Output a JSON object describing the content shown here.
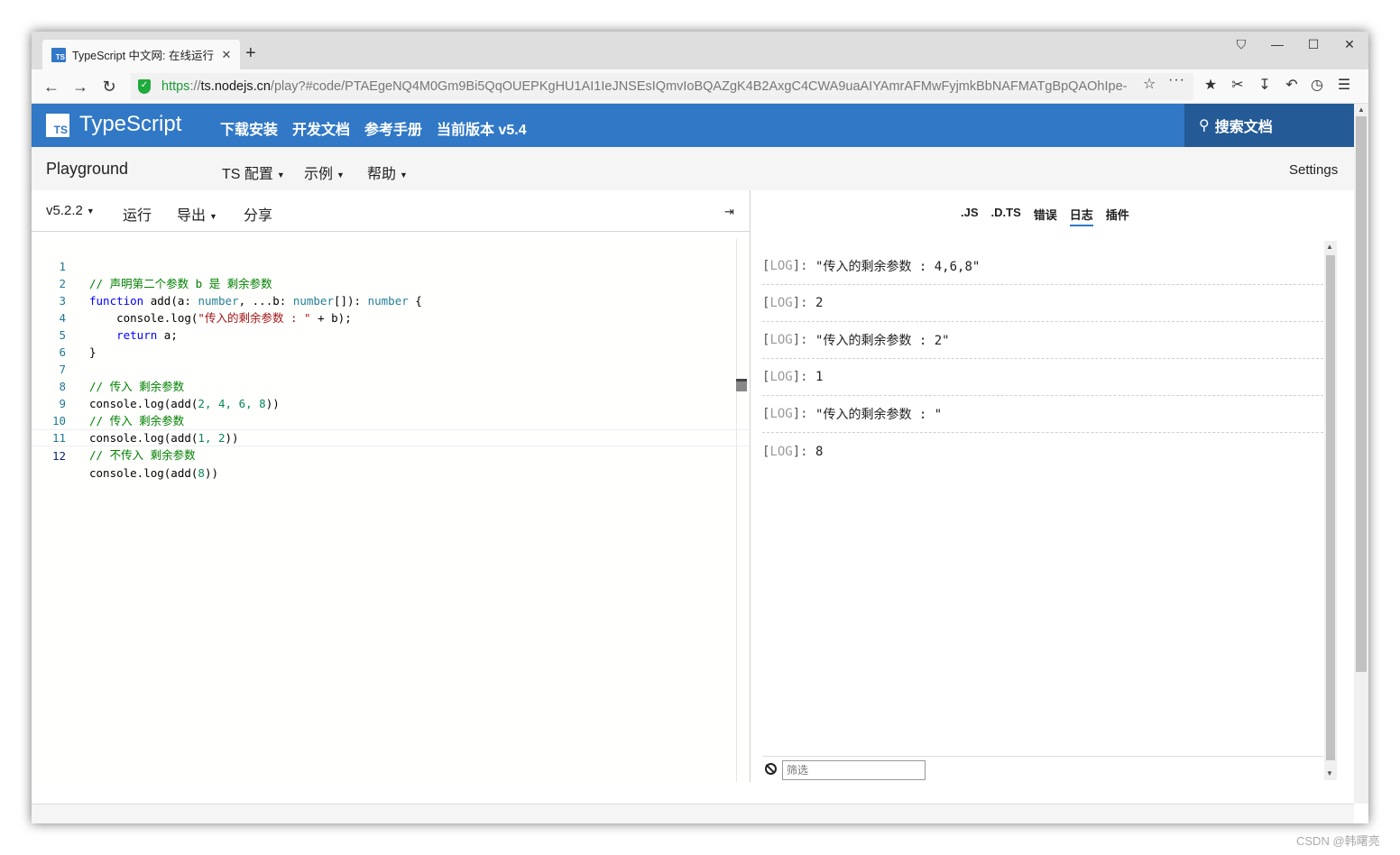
{
  "browser": {
    "tab_title": "TypeScript 中文网: 在线运行",
    "tab_favicon": "TS",
    "tab_close": "✕",
    "new_tab": "+",
    "url_scheme": "https",
    "url_sep": "://",
    "url_host": "ts.nodejs.cn",
    "url_rest": "/play?#code/PTAEgeNQ4M0Gm9Bi5QqOUEPKgHU1AI1IeJNSEsIQmvIoBQAZgK4B2AxgC4CWA9uaAIYAmrAFMwFyjmkBbNAFMATgBpQAOhIpe-",
    "window_controls": [
      "⛉",
      "—",
      "☐",
      "✕"
    ],
    "nav_icons": [
      "arrow-left-icon",
      "arrow-right-icon",
      "reload-icon"
    ],
    "toolbar_icons": [
      "star-list-icon",
      "scissors-icon",
      "download-icon",
      "undo-icon",
      "history-icon",
      "menu-icon"
    ]
  },
  "site": {
    "logo_box": "TS",
    "logo_text": "TypeScript",
    "nav": [
      "下载安装",
      "开发文档",
      "参考手册",
      "当前版本 v5.4"
    ],
    "search_label": "搜索文档",
    "brand_color": "#3178c6"
  },
  "playground": {
    "title": "Playground",
    "menus": [
      "TS 配置",
      "示例",
      "帮助"
    ],
    "settings": "Settings"
  },
  "editor_toolbar": {
    "version": "v5.2.2",
    "run": "运行",
    "export": "导出",
    "share": "分享",
    "collapse": "⇥"
  },
  "code_lines": [
    {
      "n": "1"
    },
    {
      "n": "2"
    },
    {
      "n": "3"
    },
    {
      "n": "4"
    },
    {
      "n": "5"
    },
    {
      "n": "6"
    },
    {
      "n": "7"
    },
    {
      "n": "8"
    },
    {
      "n": "9"
    },
    {
      "n": "10"
    },
    {
      "n": "11"
    },
    {
      "n": "12"
    }
  ],
  "code": {
    "l1": "// 声明第二个参数 b 是 剩余参数",
    "l2_fn": "function",
    "l2_a": " add(a: ",
    "l2_t1": "number",
    "l2_b": ", ...b: ",
    "l2_t2": "number",
    "l2_c": "[]): ",
    "l2_t3": "number",
    "l2_d": " {",
    "l3_a": "    console.log(",
    "l3_s": "\"传入的剩余参数 : \"",
    "l3_b": " + b);",
    "l4_k": "    return",
    "l4_b": " a;",
    "l5": "}",
    "l6": "",
    "l7": "// 传入 剩余参数",
    "l8_a": "console.log(add(",
    "l8_n": "2, 4, 6, 8",
    "l8_b": "))",
    "l9": "// 传入 剩余参数",
    "l10_a": "console.log(add(",
    "l10_n": "1, 2",
    "l10_b": "))",
    "l11": "// 不传入 剩余参数",
    "l12_a": "console.log(add(",
    "l12_n": "8",
    "l12_b": "))"
  },
  "right_tabs": [
    ".JS",
    ".D.TS",
    "错误",
    "日志",
    "插件"
  ],
  "log_tag": "LOG",
  "logs": [
    "\"传入的剩余参数 : 4,6,8\"",
    "2",
    "\"传入的剩余参数 : 2\"",
    "1",
    "\"传入的剩余参数 : \"",
    "8"
  ],
  "filter": {
    "placeholder": "筛选"
  },
  "watermark": "CSDN @韩曙亮"
}
